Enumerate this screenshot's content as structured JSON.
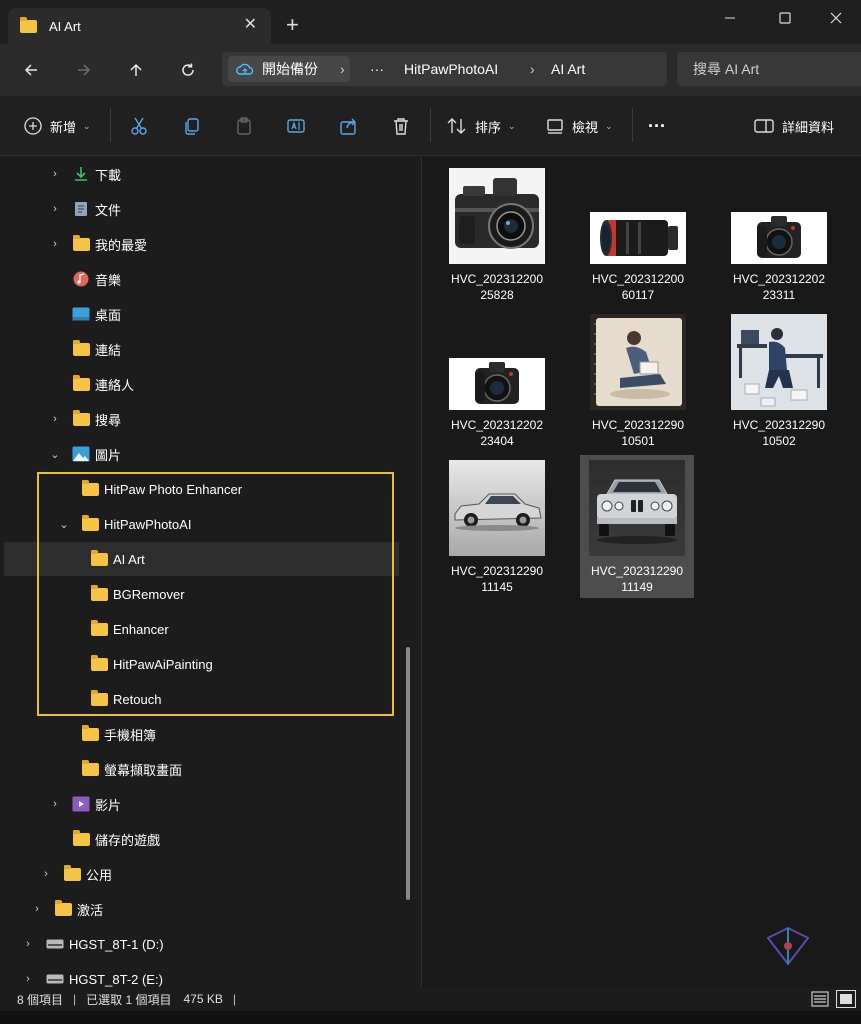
{
  "window": {
    "tab_title": "AI Art",
    "tab_close": "✕",
    "new_tab": "+"
  },
  "address": {
    "first_crumb": "開始備份",
    "ellipsis": "···",
    "crumbs": [
      "HitPawPhotoAI",
      "AI Art"
    ],
    "search_placeholder": "搜尋 AI Art"
  },
  "toolbar": {
    "new_label": "新增",
    "sort_label": "排序",
    "view_label": "檢視",
    "more_label": "···",
    "details_label": "詳細資料"
  },
  "sidebar": {
    "items": [
      {
        "label": "下載",
        "icon": "download-icon"
      },
      {
        "label": "文件",
        "icon": "document-icon"
      },
      {
        "label": "我的最愛",
        "icon": "folder-icon"
      },
      {
        "label": "音樂",
        "icon": "music-icon"
      },
      {
        "label": "桌面",
        "icon": "desktop-icon"
      },
      {
        "label": "連結",
        "icon": "folder-icon"
      },
      {
        "label": "連絡人",
        "icon": "folder-icon"
      },
      {
        "label": "搜尋",
        "icon": "folder-icon"
      },
      {
        "label": "圖片",
        "icon": "pictures-icon"
      },
      {
        "label": "HitPaw Photo Enhancer",
        "icon": "folder-icon"
      },
      {
        "label": "HitPawPhotoAI",
        "icon": "folder-icon"
      },
      {
        "label": "AI Art",
        "icon": "folder-icon"
      },
      {
        "label": "BGRemover",
        "icon": "folder-icon"
      },
      {
        "label": "Enhancer",
        "icon": "folder-icon"
      },
      {
        "label": "HitPawAiPainting",
        "icon": "folder-icon"
      },
      {
        "label": "Retouch",
        "icon": "folder-icon"
      },
      {
        "label": "手機相簿",
        "icon": "folder-icon"
      },
      {
        "label": "螢幕擷取畫面",
        "icon": "folder-icon"
      },
      {
        "label": "影片",
        "icon": "videos-icon"
      },
      {
        "label": "儲存的遊戲",
        "icon": "folder-icon"
      },
      {
        "label": "公用",
        "icon": "folder-icon"
      },
      {
        "label": "激活",
        "icon": "folder-icon"
      },
      {
        "label": "HGST_8T-1 (D:)",
        "icon": "drive-icon"
      },
      {
        "label": "HGST_8T-2 (E:)",
        "icon": "drive-icon"
      }
    ]
  },
  "files": [
    {
      "line1": "HVC_202312200",
      "line2": "25828",
      "thumb": "camera-retro-thumbnail"
    },
    {
      "line1": "HVC_202312200",
      "line2": "60117",
      "thumb": "lens-thumbnail"
    },
    {
      "line1": "HVC_202312202",
      "line2": "23311",
      "thumb": "mirrorless-camera-thumbnail"
    },
    {
      "line1": "HVC_202312202",
      "line2": "23404",
      "thumb": "mirrorless-camera-thumbnail"
    },
    {
      "line1": "HVC_202312290",
      "line2": "10501",
      "thumb": "sketch-man-thumbnail"
    },
    {
      "line1": "HVC_202312290",
      "line2": "10502",
      "thumb": "desk-man-thumbnail"
    },
    {
      "line1": "HVC_202312290",
      "line2": "11145",
      "thumb": "silver-car-side-thumbnail"
    },
    {
      "line1": "HVC_202312290",
      "line2": "11149",
      "thumb": "silver-car-front-thumbnail"
    }
  ],
  "status": {
    "count": "8 個項目",
    "selected": "已選取 1 個項目",
    "size": "475 KB",
    "separator": "|"
  },
  "colors": {
    "folder": "#f6c444",
    "highlight": "#e8c12d",
    "accent": "#4cc2ff"
  }
}
